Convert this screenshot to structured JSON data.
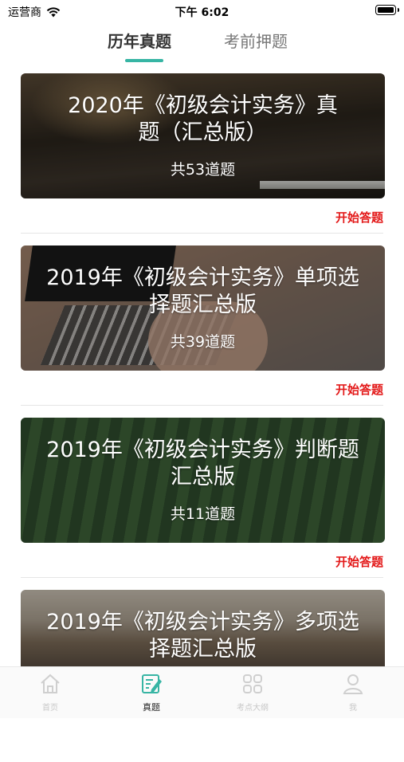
{
  "status_bar": {
    "carrier": "运营商",
    "time": "下午 6:02"
  },
  "top_tabs": [
    {
      "label": "历年真题",
      "active": true
    },
    {
      "label": "考前押题",
      "active": false
    }
  ],
  "papers": [
    {
      "title": "2020年《初级会计实务》真题（汇总版）",
      "count": "共53道题",
      "action": "开始答题"
    },
    {
      "title": "2019年《初级会计实务》单项选择题汇总版",
      "count": "共39道题",
      "action": "开始答题"
    },
    {
      "title": "2019年《初级会计实务》判断题汇总版",
      "count": "共11道题",
      "action": "开始答题"
    },
    {
      "title": "2019年《初级会计实务》多项选择题汇总版",
      "count": "",
      "action": ""
    }
  ],
  "bottom_nav": [
    {
      "label": "首页",
      "icon": "home-icon",
      "active": false
    },
    {
      "label": "真题",
      "icon": "edit-icon",
      "active": true
    },
    {
      "label": "考点大纲",
      "icon": "grid-icon",
      "active": false
    },
    {
      "label": "我",
      "icon": "user-icon",
      "active": false
    }
  ],
  "colors": {
    "accent": "#37b5a4",
    "action": "#e31a1a"
  }
}
